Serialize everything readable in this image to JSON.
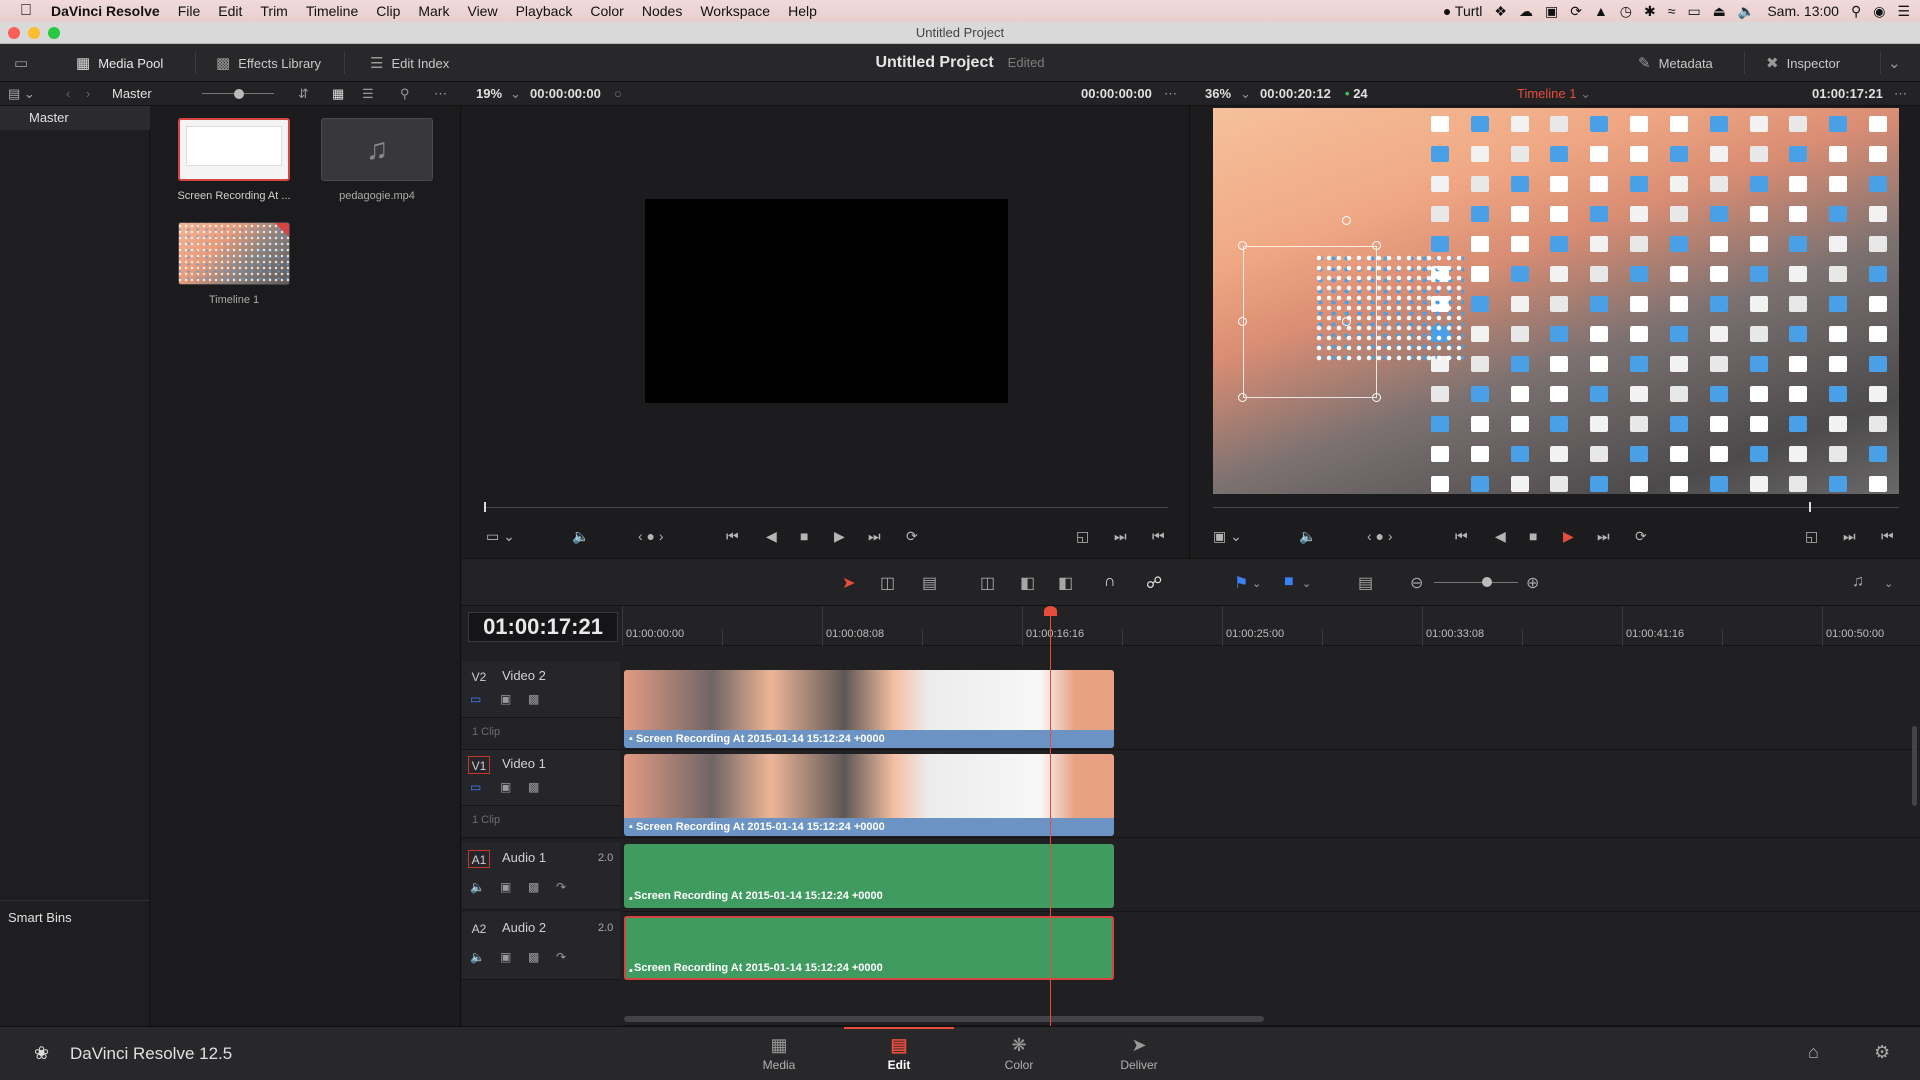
{
  "menubar": {
    "app": "DaVinci Resolve",
    "items": [
      "File",
      "Edit",
      "Trim",
      "Timeline",
      "Clip",
      "Mark",
      "View",
      "Playback",
      "Color",
      "Nodes",
      "Workspace",
      "Help"
    ],
    "user": "Turtl",
    "clock": "Sam. 13:00"
  },
  "window": {
    "title": "Untitled Project"
  },
  "toolbar": {
    "media_pool": "Media Pool",
    "effects_library": "Effects Library",
    "edit_index": "Edit Index",
    "project_title": "Untitled Project",
    "project_status": "Edited",
    "metadata": "Metadata",
    "inspector": "Inspector"
  },
  "subbar": {
    "bin": "Master",
    "src_zoom": "19%",
    "src_tc": "00:00:00:00",
    "src_tc_right": "00:00:00:00",
    "tl_zoom": "36%",
    "tl_duration": "00:00:20:12",
    "fps": "24",
    "timeline_name": "Timeline 1",
    "tl_tc": "01:00:17:21"
  },
  "bins": {
    "master": "Master",
    "smart_bins": "Smart Bins"
  },
  "pool": {
    "clips": [
      {
        "label": "Screen Recording At ..."
      },
      {
        "label": "pedagogie.mp4"
      },
      {
        "label": "Timeline 1"
      }
    ]
  },
  "timeline": {
    "timecode": "01:00:17:21",
    "ruler": [
      "01:00:00:00",
      "01:00:08:08",
      "01:00:16:16",
      "01:00:25:00",
      "01:00:33:08",
      "01:00:41:16",
      "01:00:50:00"
    ],
    "tracks": [
      {
        "code": "V2",
        "name": "Video 2",
        "clips": "1 Clip",
        "clip_name": "Screen Recording At 2015-01-14 15:12:24 +0000"
      },
      {
        "code": "V1",
        "name": "Video 1",
        "clips": "1 Clip",
        "clip_name": "Screen Recording At 2015-01-14 15:12:24 +0000"
      },
      {
        "code": "A1",
        "name": "Audio 1",
        "ch": "2.0",
        "clip_name": "Screen Recording At 2015-01-14 15:12:24 +0000"
      },
      {
        "code": "A2",
        "name": "Audio 2",
        "ch": "2.0",
        "clip_name": "Screen Recording At 2015-01-14 15:12:24 +0000"
      }
    ]
  },
  "footer": {
    "brand": "DaVinci Resolve 12.5",
    "pages": [
      "Media",
      "Edit",
      "Color",
      "Deliver"
    ]
  }
}
